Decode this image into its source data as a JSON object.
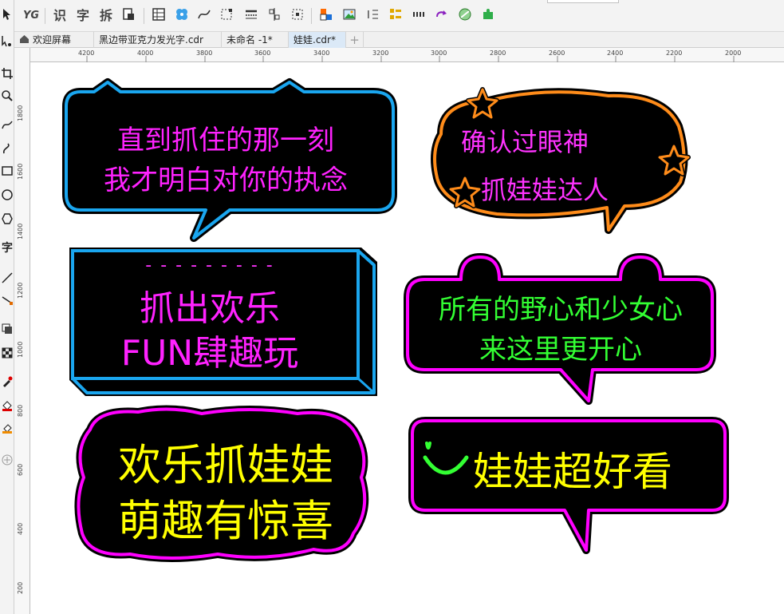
{
  "toolbar": {
    "items": [
      {
        "label": "YG"
      },
      {
        "label": "识"
      },
      {
        "label": "字"
      },
      {
        "label": "拆"
      }
    ]
  },
  "tabs": [
    {
      "label": "欢迎屏幕"
    },
    {
      "label": "黑边带亚克力发光字.cdr"
    },
    {
      "label": "未命名 -1*"
    },
    {
      "label": "娃娃.cdr*"
    }
  ],
  "toolpanel": {
    "text_tool_label": "字"
  },
  "hruler": {
    "ticks": [
      "4200",
      "4000",
      "3800",
      "3600",
      "3400",
      "3200",
      "3000",
      "2800",
      "2600",
      "2400",
      "2200",
      "2000"
    ]
  },
  "vruler": {
    "ticks": [
      "1800",
      "1600",
      "1400",
      "1200",
      "1000",
      "800",
      "600",
      "400",
      "200"
    ]
  },
  "stickers": {
    "s1": {
      "line1": "直到抓住的那一刻",
      "line2": "我才明白对你的执念"
    },
    "s2": {
      "line1": "确认过眼神",
      "line2": "抓娃娃达人"
    },
    "s3": {
      "dashes": "- - - - - - - - -",
      "line1": "抓出欢乐",
      "line2": "FUN肆趣玩"
    },
    "s4": {
      "line1": "所有的野心和少女心",
      "line2": "来这里更开心"
    },
    "s5": {
      "line1": "欢乐抓娃娃",
      "line2": "萌趣有惊喜"
    },
    "s6": {
      "smile": "◡",
      "line1": "娃娃超好看"
    }
  },
  "colors": {
    "cyan": "#1aa6ef",
    "magenta": "#ff00ff",
    "orange": "#ff8c1a",
    "green": "#33ff33",
    "yellow": "#ffff00",
    "black": "#000000"
  }
}
